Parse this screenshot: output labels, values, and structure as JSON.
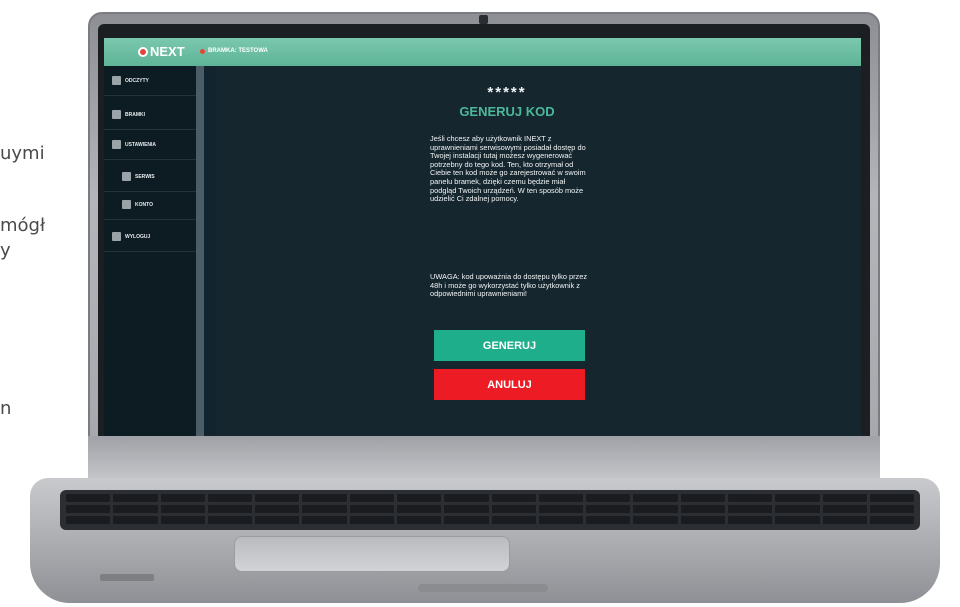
{
  "background_text": {
    "frag1": "uymi",
    "frag2": "mógł",
    "frag3": "y",
    "frag4": "n"
  },
  "app": {
    "logo": "NEXT",
    "breadcrumb": "BRAMKA: TESTOWA"
  },
  "sidebar": {
    "items": [
      {
        "label": "ODCZYTY",
        "icon": "grid-icon"
      },
      {
        "label": "BRAMKI",
        "icon": "device-icon"
      },
      {
        "label": "USTAWIENIA",
        "icon": "gear-icon"
      },
      {
        "label": "SERWIS",
        "icon": "wrench-icon"
      },
      {
        "label": "KONTO",
        "icon": "user-icon"
      },
      {
        "label": "WYLOGUJ",
        "icon": "logout-icon"
      }
    ]
  },
  "main": {
    "stars": "*****",
    "title": "GENERUJ KOD",
    "body": "Jeśli chcesz aby użytkownik INEXT z uprawnieniami serwisowymi posiadał dostęp do Twojej instalacji tutaj możesz wygenerować potrzebny do tego kod. Ten, kto otrzymał od Ciebie ten kod może go zarejestrować w swoim panelu bramek, dzięki czemu będzie miał podgląd Twoich urządzeń. W ten sposób może udzielić Ci zdalnej pomocy.",
    "warning": "UWAGA: kod upoważnia do dostępu tylko przez 48h i może go wykorzystać tylko użytkownik z odpowiednimi uprawnieniami!",
    "generate_label": "GENERUJ",
    "cancel_label": "ANULUJ"
  },
  "colors": {
    "topbar": "#6bbda2",
    "accent": "#4cb89a",
    "generate": "#1fae8c",
    "cancel": "#ed1c24"
  }
}
